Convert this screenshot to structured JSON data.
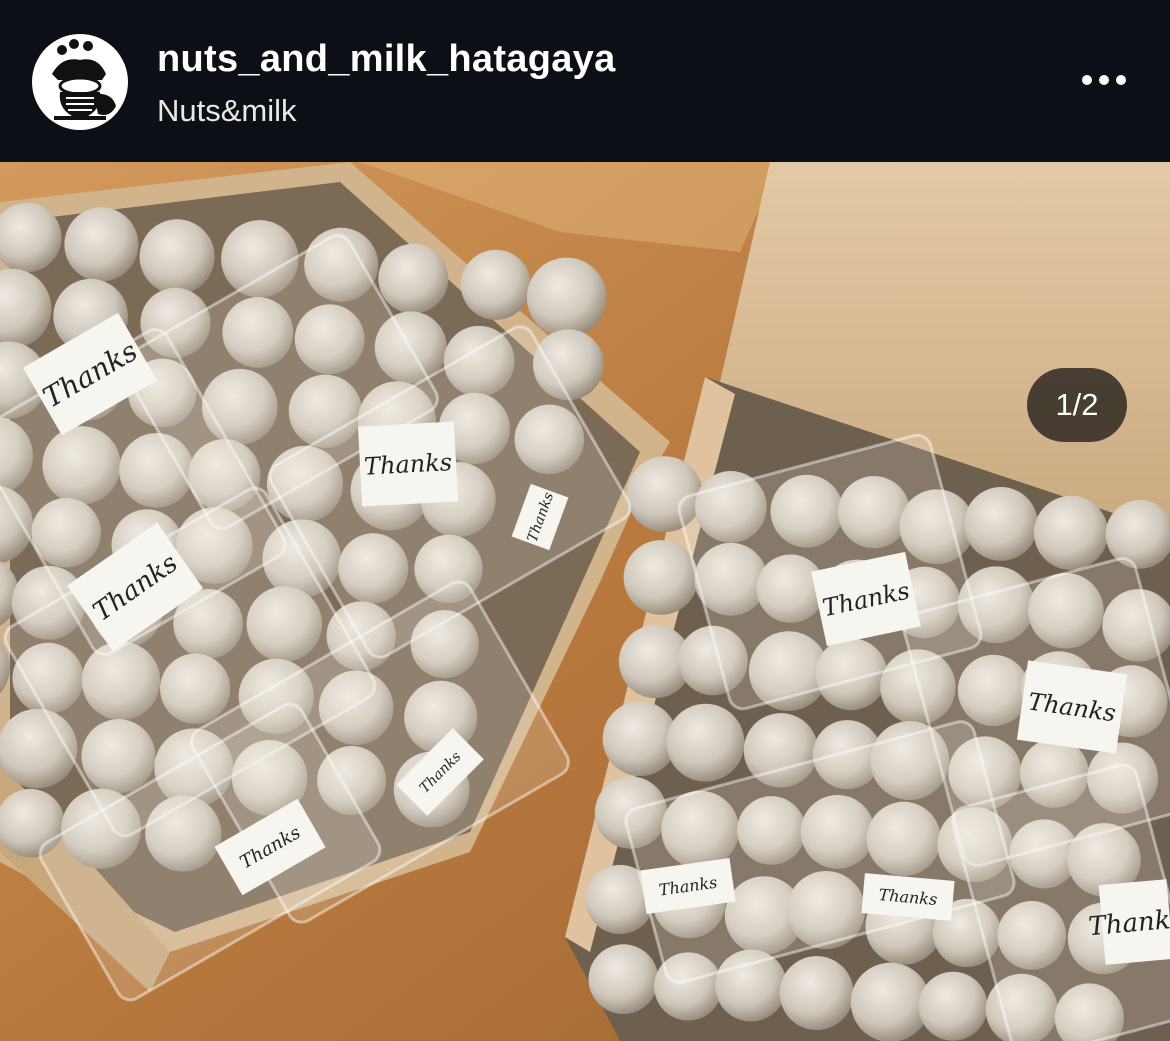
{
  "post_header": {
    "username": "nuts_and_milk_hatagaya",
    "subtitle": "Nuts&milk",
    "avatar_icon": "mascot-logo-icon",
    "more_icon": "more-options-icon"
  },
  "carousel": {
    "counter": "1/2",
    "current_index": 1,
    "total": 2
  },
  "photo": {
    "sticker_label": "Thanks",
    "colors": {
      "table": "#c8884a",
      "box": "#d6b892",
      "cookie": "#d9d3c8",
      "bag": "#e8e2d6"
    }
  }
}
